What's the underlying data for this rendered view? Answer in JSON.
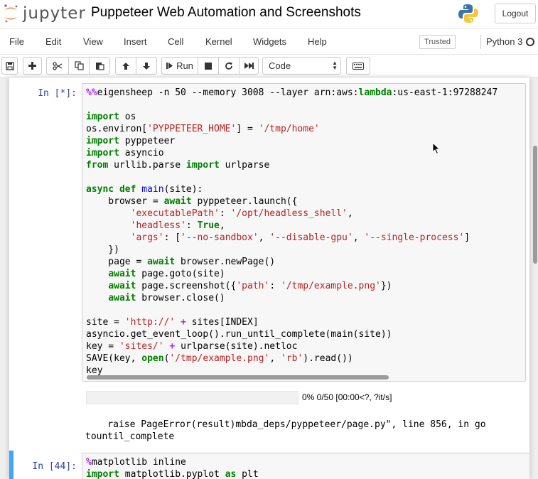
{
  "header": {
    "logo_text": "jupyter",
    "notebook_title": "Puppeteer Web Automation and Screenshots",
    "logout_label": "Logout"
  },
  "menu": {
    "items": [
      "File",
      "Edit",
      "View",
      "Insert",
      "Cell",
      "Kernel",
      "Widgets",
      "Help"
    ],
    "trusted_label": "Trusted",
    "kernel_name": "Python 3"
  },
  "toolbar": {
    "run_label": "Run",
    "cell_type": "Code",
    "icons": [
      "save-icon",
      "plus-icon",
      "cut-icon",
      "copy-icon",
      "paste-icon",
      "arrow-up-icon",
      "arrow-down-icon",
      "step-forward-icon",
      "stop-icon",
      "restart-icon",
      "fast-forward-icon",
      "keyboard-icon"
    ]
  },
  "cells": {
    "cell1": {
      "prompt": "In [*]:",
      "progress_text": "0% 0/50 [00:00<?, ?it/s]",
      "output_line1": "    raise PageError(result)mbda_deps/pyppeteer/page.py\", line 856, in go",
      "output_line2": "tountil_complete"
    },
    "cell2": {
      "prompt": "In [44]:"
    }
  }
}
